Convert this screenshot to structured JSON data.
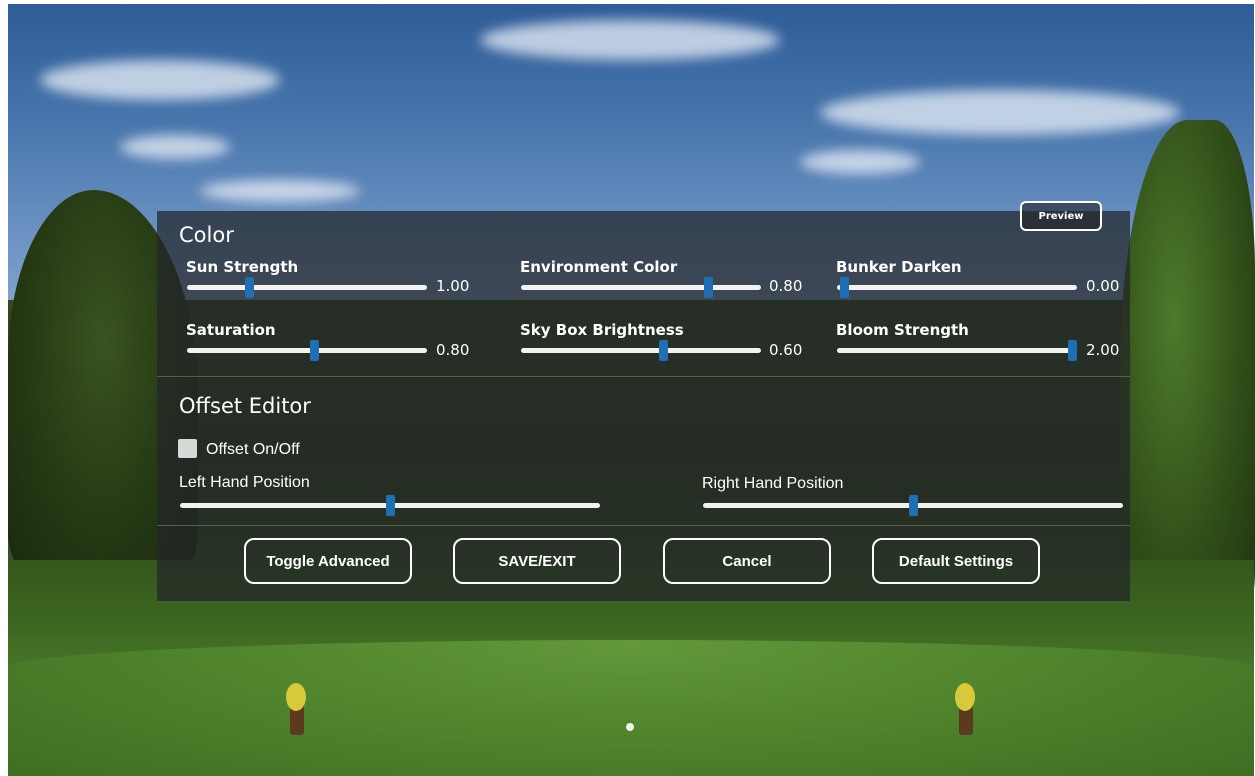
{
  "color_section": {
    "title": "Color",
    "sliders": [
      {
        "label": "Sun Strength",
        "value_text": "1.00",
        "fraction": 0.26
      },
      {
        "label": "Environment Color",
        "value_text": "0.80",
        "fraction": 0.78
      },
      {
        "label": "Bunker Darken",
        "value_text": "0.00",
        "fraction": 0.03
      },
      {
        "label": "Saturation",
        "value_text": "0.80",
        "fraction": 0.53
      },
      {
        "label": "Sky Box Brightness",
        "value_text": "0.60",
        "fraction": 0.59
      },
      {
        "label": "Bloom Strength",
        "value_text": "2.00",
        "fraction": 0.98
      }
    ]
  },
  "preview_button": "Preview",
  "offset_section": {
    "title": "Offset Editor",
    "toggle_label": "Offset On/Off",
    "toggle_checked": false,
    "left_hand": {
      "label": "Left Hand Position",
      "fraction": 0.5
    },
    "right_hand": {
      "label": "Right Hand Position",
      "fraction": 0.5
    }
  },
  "buttons": {
    "toggle_advanced": "Toggle Advanced",
    "save_exit": "SAVE/EXIT",
    "cancel": "Cancel",
    "default_settings": "Default Settings"
  },
  "colors": {
    "slider_thumb": "#1f6fb5",
    "panel_bg": "rgba(35,37,40,0.72)"
  }
}
